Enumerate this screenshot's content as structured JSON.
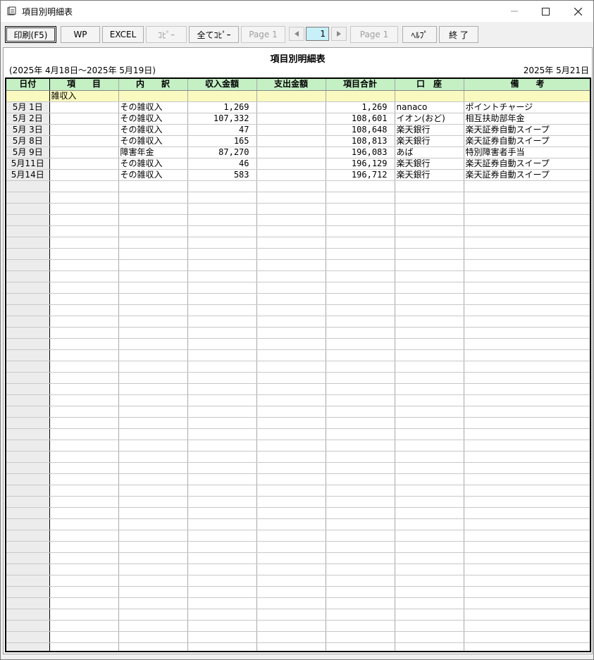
{
  "window": {
    "title": "項目別明細表"
  },
  "toolbar": {
    "print": "印刷(F5)",
    "wp": "WP",
    "excel": "EXCEL",
    "copy": "ｺﾋﾟｰ",
    "copy_all": "全てｺﾋﾟｰ",
    "page_left": "Page 1",
    "page_value": "1",
    "page_right": "Page 1",
    "help": "ﾍﾙﾌﾟ",
    "exit": "終 了"
  },
  "report": {
    "title": "項目別明細表",
    "period": "(2025年 4月18日～2025年 5月19日)",
    "date": "2025年 5月21日"
  },
  "table": {
    "headers": [
      "日付",
      "項　　目",
      "内　　訳",
      "収入金額",
      "支出金額",
      "項目合計",
      "口　座",
      "備　　考"
    ],
    "category": "雑収入",
    "rows": [
      {
        "date": "5月 1日",
        "breakdown": "その雑収入",
        "income": "1,269",
        "total": "1,269",
        "account": "nanaco",
        "note": "ポイントチャージ"
      },
      {
        "date": "5月 2日",
        "breakdown": "その雑収入",
        "income": "107,332",
        "total": "108,601",
        "account": "イオン(おど)",
        "note": "相互扶助部年金"
      },
      {
        "date": "5月 3日",
        "breakdown": "その雑収入",
        "income": "47",
        "total": "108,648",
        "account": "楽天銀行",
        "note": "楽天証券自動スイープ"
      },
      {
        "date": "5月 8日",
        "breakdown": "その雑収入",
        "income": "165",
        "total": "108,813",
        "account": "楽天銀行",
        "note": "楽天証券自動スイープ"
      },
      {
        "date": "5月 9日",
        "breakdown": "障害年金",
        "income": "87,270",
        "total": "196,083",
        "account": "あば",
        "note": "特別障害者手当"
      },
      {
        "date": "5月11日",
        "breakdown": "その雑収入",
        "income": "46",
        "total": "196,129",
        "account": "楽天銀行",
        "note": "楽天証券自動スイープ"
      },
      {
        "date": "5月14日",
        "breakdown": "その雑収入",
        "income": "583",
        "total": "196,712",
        "account": "楽天銀行",
        "note": "楽天証券自動スイープ"
      }
    ]
  }
}
